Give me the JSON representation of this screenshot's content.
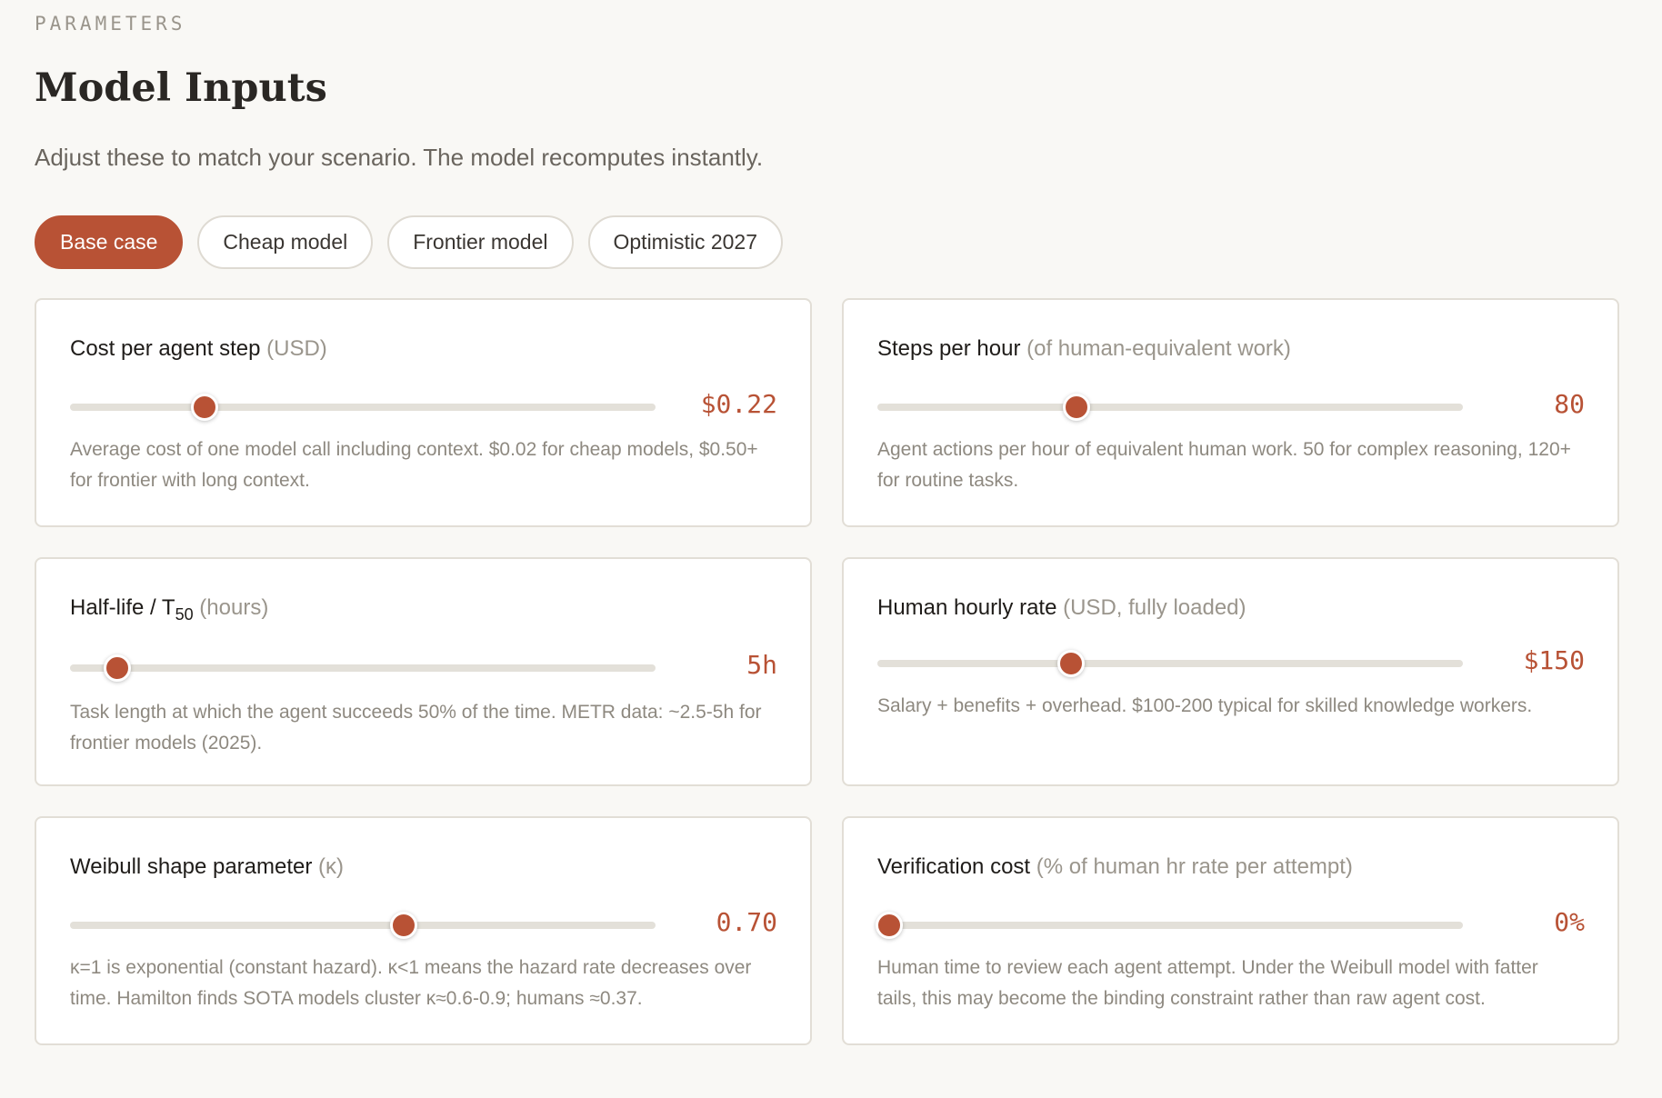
{
  "header": {
    "eyebrow": "PARAMETERS",
    "title": "Model Inputs",
    "subtitle": "Adjust these to match your scenario. The model recomputes instantly."
  },
  "presets": [
    {
      "label": "Base case",
      "active": true
    },
    {
      "label": "Cheap model",
      "active": false
    },
    {
      "label": "Frontier model",
      "active": false
    },
    {
      "label": "Optimistic 2027",
      "active": false
    }
  ],
  "params": {
    "cost_per_step": {
      "label": "Cost per agent step",
      "unit": "(USD)",
      "value": "$0.22",
      "slider_fraction": 0.23,
      "description": "Average cost of one model call including context. $0.02 for cheap models, $0.50+ for frontier with long context."
    },
    "steps_per_hour": {
      "label": "Steps per hour",
      "unit": "(of human-equivalent work)",
      "value": "80",
      "slider_fraction": 0.34,
      "description": "Agent actions per hour of equivalent human work. 50 for complex reasoning, 120+ for routine tasks."
    },
    "half_life": {
      "label_main": "Half-life / T",
      "label_sub": "50",
      "unit": "(hours)",
      "value": "5h",
      "slider_fraction": 0.08,
      "description": "Task length at which the agent succeeds 50% of the time. METR data: ~2.5-5h for frontier models (2025)."
    },
    "human_rate": {
      "label": "Human hourly rate",
      "unit": "(USD, fully loaded)",
      "value": "$150",
      "slider_fraction": 0.33,
      "description": "Salary + benefits + overhead. $100-200 typical for skilled knowledge workers."
    },
    "weibull_shape": {
      "label": "Weibull shape parameter",
      "unit": "(κ)",
      "value": "0.70",
      "slider_fraction": 0.57,
      "description": "κ=1 is exponential (constant hazard). κ<1 means the hazard rate decreases over time. Hamilton finds SOTA models cluster κ≈0.6-0.9; humans ≈0.37."
    },
    "verification_cost": {
      "label": "Verification cost",
      "unit": "(% of human hr rate per attempt)",
      "value": "0%",
      "slider_fraction": 0.02,
      "description": "Human time to review each agent attempt. Under the Weibull model with fatter tails, this may become the binding constraint rather than raw agent cost."
    }
  },
  "colors": {
    "accent": "#b85235",
    "background": "#f9f8f5",
    "track": "#e3e0d9"
  }
}
